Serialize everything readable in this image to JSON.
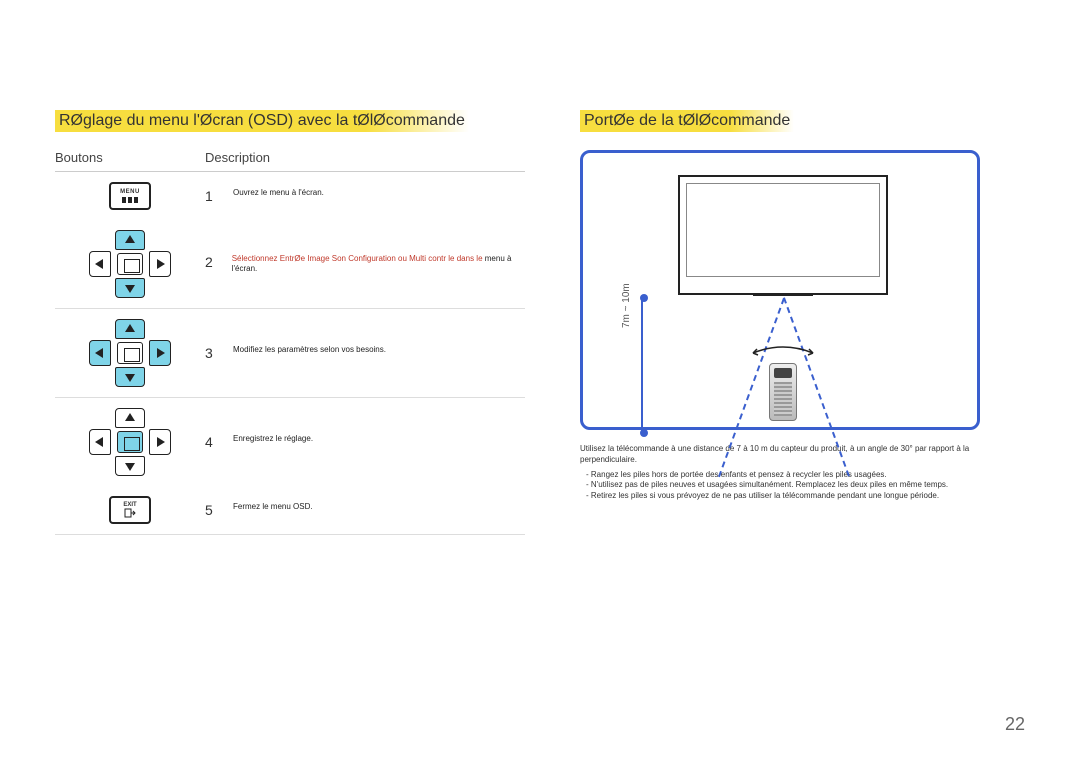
{
  "page_number": "22",
  "left": {
    "title": "RØglage du menu   l'Øcran (OSD) avec la tØlØcommande",
    "head_buttons": "Boutons",
    "head_desc": "Description",
    "steps": {
      "s1": {
        "num": "1",
        "text": "Ouvrez le menu à l'écran."
      },
      "s2": {
        "num": "2",
        "text_red": "Sélectionnez EntrØe Image Son Configuration ou Multi contr le dans le",
        "text_plain": "menu à l'écran."
      },
      "s3": {
        "num": "3",
        "text": "Modifiez les paramètres selon vos besoins."
      },
      "s4": {
        "num": "4",
        "text": "Enregistrez le réglage."
      },
      "s5": {
        "num": "5",
        "text": "Fermez le menu OSD."
      }
    }
  },
  "right": {
    "title": "PortØe de la tØlØcommande",
    "distance_label": "7m ~ 10m",
    "note_main": "Utilisez la télécommande à une distance de 7 à 10 m du capteur du produit, à un angle de 30° par rapport à la perpendiculaire.",
    "bullets": [
      "Rangez les piles hors de portée des enfants et pensez à recycler les piles usagées.",
      "N'utilisez pas de piles neuves et usagées simultanément. Remplacez les deux piles en même temps.",
      "Retirez les piles si vous prévoyez de ne pas utiliser la télécommande pendant une longue période."
    ]
  },
  "icons": {
    "menu_label": "MENU",
    "exit_label": "EXIT"
  }
}
